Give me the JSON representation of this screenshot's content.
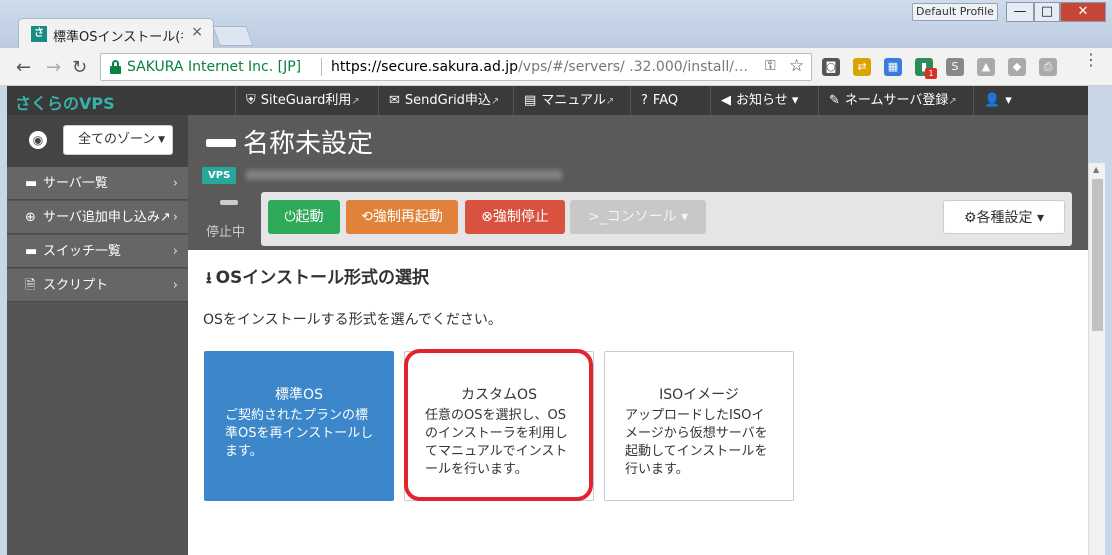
{
  "browser": {
    "tab_title": "標準OSインストール(名",
    "tab_favicon": "さ",
    "tab_close": "×",
    "profile": "Default Profile",
    "win_min": "—",
    "win_max": "□",
    "win_close": "✕",
    "back": "←",
    "forward": "→",
    "reload": "↻",
    "site_identity": "SAKURA Internet Inc. [JP]",
    "url_host": "https://secure.sakura.ad.jp",
    "url_path": "/vps/#/servers/ .32.000/install/…",
    "key": "⚿",
    "star": "☆",
    "extensions": [
      {
        "name": "pocket-icon",
        "glyph": "◙",
        "color": "#555555"
      },
      {
        "name": "extension-icon",
        "glyph": "⇄",
        "color": "#d9a400"
      },
      {
        "name": "calendar-icon",
        "glyph": "▦",
        "color": "#3b7bdc"
      },
      {
        "name": "stats-icon",
        "glyph": "▮",
        "color": "#2e8b57"
      },
      {
        "name": "s-icon",
        "glyph": "S",
        "color": "#888888"
      },
      {
        "name": "drive-icon",
        "glyph": "▲",
        "color": "#aaaaaa"
      },
      {
        "name": "dropbox-icon",
        "glyph": "◆",
        "color": "#aaaaaa"
      },
      {
        "name": "pdf-icon",
        "glyph": "⎙",
        "color": "#aaaaaa"
      }
    ],
    "extension_badge": "1",
    "menu": "⋮"
  },
  "appbar": {
    "brand": "さくらのVPS",
    "nav": [
      {
        "label": "SiteGuard利用",
        "icon": "⛨"
      },
      {
        "label": "SendGrid申込",
        "icon": "✉"
      },
      {
        "label": "マニュアル",
        "icon": "▤"
      },
      {
        "label": "FAQ",
        "icon": "?"
      },
      {
        "label": "お知らせ ▾",
        "icon": "◀"
      },
      {
        "label": "ネームサーバ登録",
        "icon": "✎"
      },
      {
        "label": "▾",
        "icon": "👤"
      }
    ],
    "external_mark": "↗"
  },
  "sidebar": {
    "zone": "全てのゾーン",
    "zone_caret": "▼",
    "items": [
      {
        "label": "サーバ一覧",
        "icon": "▬"
      },
      {
        "label": "サーバ追加申し込み↗",
        "icon": "⊕"
      },
      {
        "label": "スイッチ一覧",
        "icon": "▬"
      },
      {
        "label": "スクリプト",
        "icon": "🗎"
      }
    ],
    "chevron": "›"
  },
  "server": {
    "name": "名称未設定",
    "badge": "VPS",
    "status": "停止中",
    "actions": {
      "start": "⏻起動",
      "restart": "⟲強制再起動",
      "stop": "⊗強制停止",
      "console": ">_コンソール ▾",
      "settings": "⚙各種設定 ▾"
    }
  },
  "install": {
    "title": "OSインストール形式の選択",
    "title_icon": "⭳",
    "description": "OSをインストールする形式を選んでください。",
    "cards": [
      {
        "title": "標準OS",
        "body": "ご契約されたプランの標準OSを再インストールします。"
      },
      {
        "title": "カスタムOS",
        "body": "任意のOSを選択し、OSのインストーラを利用してマニュアルでインストールを行います。"
      },
      {
        "title": "ISOイメージ",
        "body": "アップロードしたISOイメージから仮想サーバを起動してインストールを行います。"
      }
    ]
  },
  "colors": {
    "accent_teal": "#36b3a8",
    "start_green": "#2faa5b",
    "restart_orange": "#e0823a",
    "stop_red": "#d9523f",
    "selected_blue": "#3b87c9",
    "highlight_red": "#e3232d"
  }
}
